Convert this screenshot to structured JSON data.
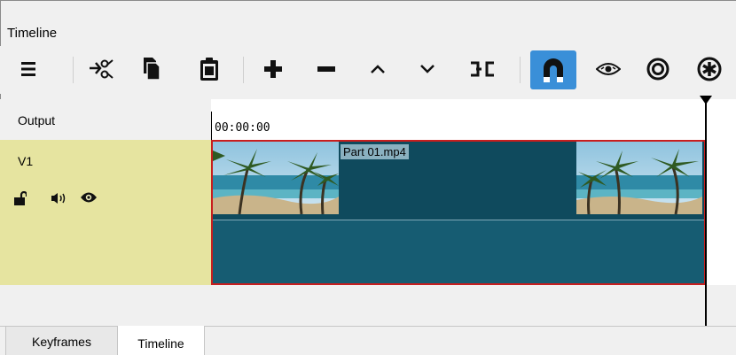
{
  "panel": {
    "title": "Timeline"
  },
  "toolbar": {
    "buttons": [
      {
        "name": "menu-icon"
      },
      {
        "name": "cut-icon"
      },
      {
        "name": "copy-icon"
      },
      {
        "name": "paste-icon"
      },
      {
        "name": "append-icon"
      },
      {
        "name": "remove-icon"
      },
      {
        "name": "lift-icon"
      },
      {
        "name": "overwrite-icon"
      },
      {
        "name": "split-icon"
      },
      {
        "name": "snap-icon",
        "active": true
      },
      {
        "name": "scrub-icon"
      },
      {
        "name": "ripple-icon"
      },
      {
        "name": "ripple-all-icon"
      }
    ],
    "accent": "#3a8fd8"
  },
  "header": {
    "output_label": "Output",
    "timecode": "00:00:00"
  },
  "tracks": [
    {
      "name": "V1",
      "header_color": "#e6e4a0",
      "icons": [
        "lock-icon",
        "audio-icon",
        "visibility-icon"
      ],
      "clip": {
        "label": "Part 01.mp4",
        "border_color": "#c81e1e",
        "fill_color": "#165c72"
      }
    }
  ],
  "tabs": [
    {
      "label": "Keyframes",
      "active": false
    },
    {
      "label": "Timeline",
      "active": true
    }
  ]
}
